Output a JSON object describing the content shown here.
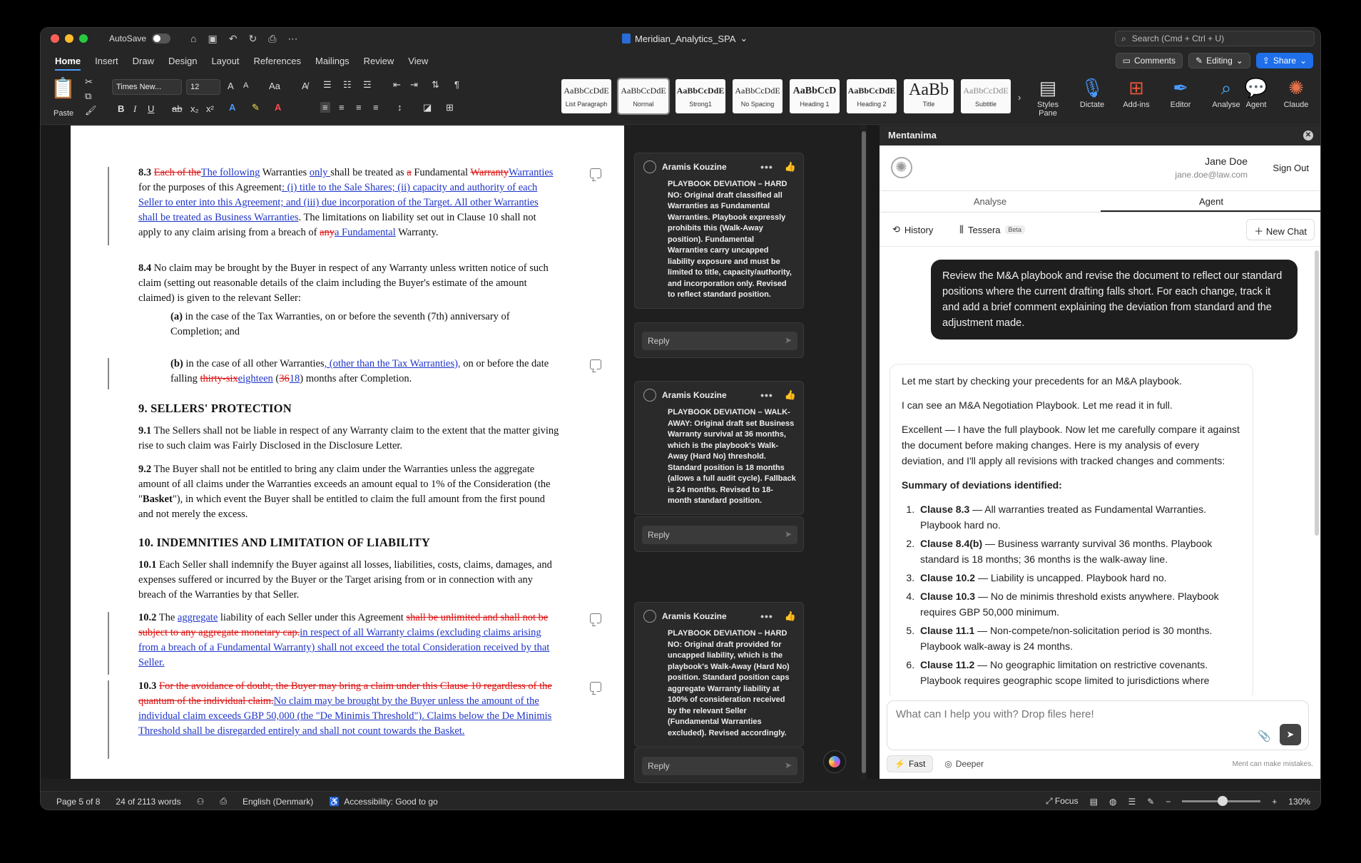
{
  "titlebar": {
    "autosave_label": "AutoSave",
    "document_title": "Meridian_Analytics_SPA",
    "search_placeholder": "Search (Cmd + Ctrl + U)"
  },
  "menu": {
    "tabs": [
      "Home",
      "Insert",
      "Draw",
      "Design",
      "Layout",
      "References",
      "Mailings",
      "Review",
      "View"
    ],
    "comments_label": "Comments",
    "editing_label": "Editing",
    "share_label": "Share"
  },
  "ribbon": {
    "paste_label": "Paste",
    "font_name": "Times New...",
    "font_size": "12",
    "styles": [
      {
        "sample": "AaBbCcDdE",
        "name": "List Paragraph"
      },
      {
        "sample": "AaBbCcDdE",
        "name": "Normal"
      },
      {
        "sample": "AaBbCcDdE",
        "name": "Strong1"
      },
      {
        "sample": "AaBbCcDdE",
        "name": "No Spacing"
      },
      {
        "sample": "AaBbCcD",
        "name": "Heading 1"
      },
      {
        "sample": "AaBbCcDdE",
        "name": "Heading 2"
      },
      {
        "sample": "AaBb",
        "name": "Title"
      },
      {
        "sample": "AaBbCcDdE",
        "name": "Subtitle"
      }
    ],
    "styles_pane_label": "Styles Pane",
    "dictate_label": "Dictate",
    "addins_label": "Add-ins",
    "editor_label": "Editor",
    "analyse_label": "Analyse",
    "agent_label": "Agent",
    "claude_label": "Claude"
  },
  "document": {
    "c83_num": "8.3",
    "c83_del1": "Each of the",
    "c83_ins1": "The following",
    "c83_t1": " Warranties ",
    "c83_ins2": "only ",
    "c83_t2": "shall be treated as ",
    "c83_del2": "a",
    "c83_t3": " Fundamental ",
    "c83_del3": "Warranty",
    "c83_ins3": "Warranties",
    "c83_t4": " for the purposes of this Agreement",
    "c83_ins4": ": (i) title to the Sale Shares; (ii) capacity and authority of each Seller to enter into this Agreement; and (iii) due incorporation of the Target. All other Warranties shall be treated as Business Warranties",
    "c83_t5": ". The limitations on liability set out in Clause 10 shall not apply to any claim arising from a breach of ",
    "c83_del4": "any",
    "c83_ins5": "a Fundamental",
    "c83_t6": " Warranty.",
    "c84_num": "8.4",
    "c84_text": " No claim may be brought by the Buyer in respect of any Warranty unless written notice of such claim (setting out reasonable details of the claim including the Buyer's estimate of the amount claimed) is given to the relevant Seller:",
    "c84a_num": "(a)",
    "c84a_text": " in the case of the Tax Warranties, on or before the seventh (7th) anniversary of Completion; and",
    "c84b_num": "(b)",
    "c84b_t1": " in the case of all other Warranties",
    "c84b_ins1": ", (other than the Tax Warranties),",
    "c84b_t2": " on or before the date falling ",
    "c84b_del1": "thirty-six",
    "c84b_ins2": "eighteen",
    "c84b_t3": " (",
    "c84b_del2": "36",
    "c84b_ins3": "18",
    "c84b_t4": ") months after Completion.",
    "h9": "9. SELLERS' PROTECTION",
    "c91_num": "9.1",
    "c91_text": " The Sellers shall not be liable in respect of any Warranty claim to the extent that the matter giving rise to such claim was Fairly Disclosed in the Disclosure Letter.",
    "c92_num": "9.2",
    "c92_t1": " The Buyer shall not be entitled to bring any claim under the Warranties unless the aggregate amount of all claims under the Warranties exceeds an amount equal to 1% of the Consideration (the \"",
    "c92_bold": "Basket",
    "c92_t2": "\"), in which event the Buyer shall be entitled to claim the full amount from the first pound and not merely the excess.",
    "h10": "10. INDEMNITIES AND LIMITATION OF LIABILITY",
    "c101_num": "10.1",
    "c101_text": " Each Seller shall indemnify the Buyer against all losses, liabilities, costs, claims, damages, and expenses suffered or incurred by the Buyer or the Target arising from or in connection with any breach of the Warranties by that Seller.",
    "c102_num": "10.2",
    "c102_t1": " The ",
    "c102_ins1": "aggregate",
    "c102_t2": " liability of each Seller under this Agreement ",
    "c102_del1": "shall be unlimited and shall not be subject to any aggregate monetary cap.",
    "c102_ins2": "in respect of all Warranty claims (excluding claims arising from a breach of a Fundamental Warranty) shall not exceed the total Consideration received by that Seller.",
    "c103_num": "10.3",
    "c103_del1": "For the avoidance of doubt, the Buyer may bring a claim under this Clause 10 regardless of the quantum of the individual claim.",
    "c103_ins1": "No claim may be brought by the Buyer unless the amount of the individual claim exceeds GBP 50,000 (the \"De Minimis Threshold\"). Claims below the De Minimis Threshold shall be disregarded entirely and shall not count towards the Basket."
  },
  "comments": [
    {
      "author": "Aramis Kouzine",
      "body": "PLAYBOOK DEVIATION – HARD NO: Original draft classified all Warranties as Fundamental Warranties. Playbook expressly prohibits this (Walk-Away position). Fundamental Warranties carry uncapped liability exposure and must be limited to title, capacity/authority, and incorporation only. Revised to reflect standard position.",
      "reply": "Reply"
    },
    {
      "author": "Aramis Kouzine",
      "body": "PLAYBOOK DEVIATION – WALK-AWAY: Original draft set Business Warranty survival at 36 months, which is the playbook's Walk-Away (Hard No) threshold. Standard position is 18 months (allows a full audit cycle). Fallback is 24 months. Revised to 18-month standard position.",
      "reply": "Reply"
    },
    {
      "author": "Aramis Kouzine",
      "body": "PLAYBOOK DEVIATION – HARD NO: Original draft provided for uncapped liability, which is the playbook's Walk-Away (Hard No) position. Standard position caps aggregate Warranty liability at 100% of consideration received by the relevant Seller (Fundamental Warranties excluded). Revised accordingly.",
      "reply": "Reply"
    }
  ],
  "panel": {
    "title": "Mentanima",
    "user_name": "Jane Doe",
    "user_email": "jane.doe@law.com",
    "sign_out": "Sign Out",
    "tabs": [
      "Analyse",
      "Agent"
    ],
    "history_label": "History",
    "tessera_label": "Tessera",
    "beta_label": "Beta",
    "new_chat_label": "New Chat",
    "user_message": "Review the M&A playbook and revise the document to reflect our standard positions where the current drafting falls short. For each change, track it and add a brief comment explaining the deviation from standard and the adjustment made.",
    "ai_p1": "Let me start by checking your precedents for an M&A playbook.",
    "ai_p2": "I can see an M&A Negotiation Playbook. Let me read it in full.",
    "ai_p3": "Excellent — I have the full playbook. Now let me carefully compare it against the document before making changes. Here is my analysis of every deviation, and I'll apply all revisions with tracked changes and comments:",
    "ai_summary": "Summary of deviations identified:",
    "deviations": [
      {
        "clause": "Clause 8.3",
        "text": " — All warranties treated as Fundamental Warranties. Playbook hard no."
      },
      {
        "clause": "Clause 8.4(b)",
        "text": " — Business warranty survival 36 months. Playbook standard is 18 months; 36 months is the walk-away line."
      },
      {
        "clause": "Clause 10.2",
        "text": " — Liability is uncapped. Playbook hard no."
      },
      {
        "clause": "Clause 10.3",
        "text": " — No de minimis threshold exists anywhere. Playbook requires GBP 50,000 minimum."
      },
      {
        "clause": "Clause 11.1",
        "text": " — Non-compete/non-solicitation period is 30 months. Playbook walk-away is 24 months."
      },
      {
        "clause": "Clause 11.2",
        "text": " — No geographic limitation on restrictive covenants. Playbook requires geographic scope limited to jurisdictions where"
      }
    ],
    "composer_placeholder": "What can I help you with? Drop files here!",
    "mode_fast": "Fast",
    "mode_deeper": "Deeper",
    "disclaimer": "Ment can make mistakes."
  },
  "status": {
    "page": "Page 5 of 8",
    "words": "24 of 2113 words",
    "language": "English (Denmark)",
    "accessibility": "Accessibility: Good to go",
    "focus": "Focus",
    "zoom": "130%"
  }
}
